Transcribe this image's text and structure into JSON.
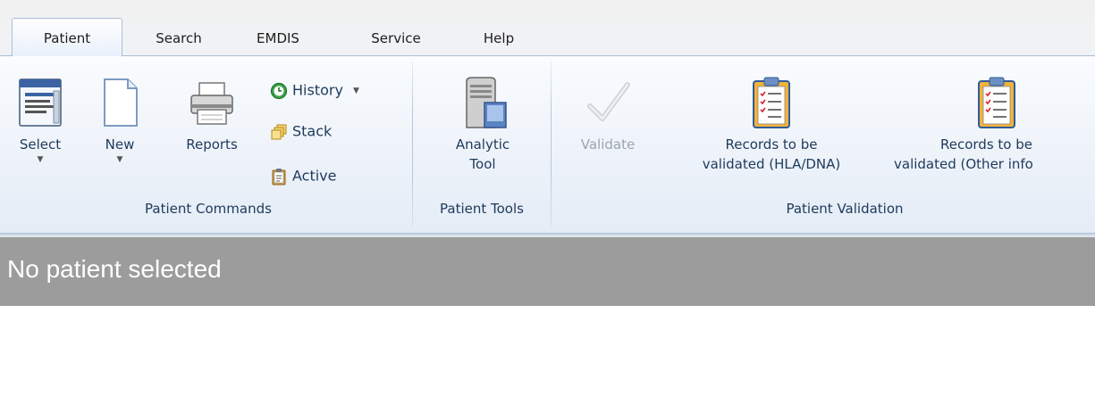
{
  "tabs": [
    {
      "label": "Patient",
      "active": true
    },
    {
      "label": "Search",
      "active": false
    },
    {
      "label": "EMDIS",
      "active": false
    },
    {
      "label": "Service",
      "active": false
    },
    {
      "label": "Help",
      "active": false
    }
  ],
  "groups": {
    "patient_commands": {
      "title": "Patient Commands",
      "select_label": "Select",
      "new_label": "New",
      "reports_label": "Reports",
      "history_label": "History",
      "stack_label": "Stack",
      "active_label": "Active"
    },
    "patient_tools": {
      "title": "Patient Tools",
      "analytic_line1": "Analytic",
      "analytic_line2": "Tool"
    },
    "patient_validation": {
      "title": "Patient Validation",
      "validate_label": "Validate",
      "hla_line1": "Records to be",
      "hla_line2": "validated (HLA/DNA)",
      "other_line1": "Records to be",
      "other_line2": "validated (Other info"
    }
  },
  "status": {
    "text": "No patient selected"
  },
  "icons": {
    "select": "list-window-icon",
    "new": "blank-page-icon",
    "reports": "printer-icon",
    "history": "history-clock-icon",
    "stack": "stack-icon",
    "active": "clipboard-icon",
    "analytic": "server-computer-icon",
    "validate": "checkmark-icon",
    "records": "clipboard-checklist-icon"
  },
  "colors": {
    "ribbon_text": "#1e395b",
    "disabled_text": "#9aa4b0",
    "status_bg": "#9c9c9c",
    "status_text": "#ffffff"
  }
}
